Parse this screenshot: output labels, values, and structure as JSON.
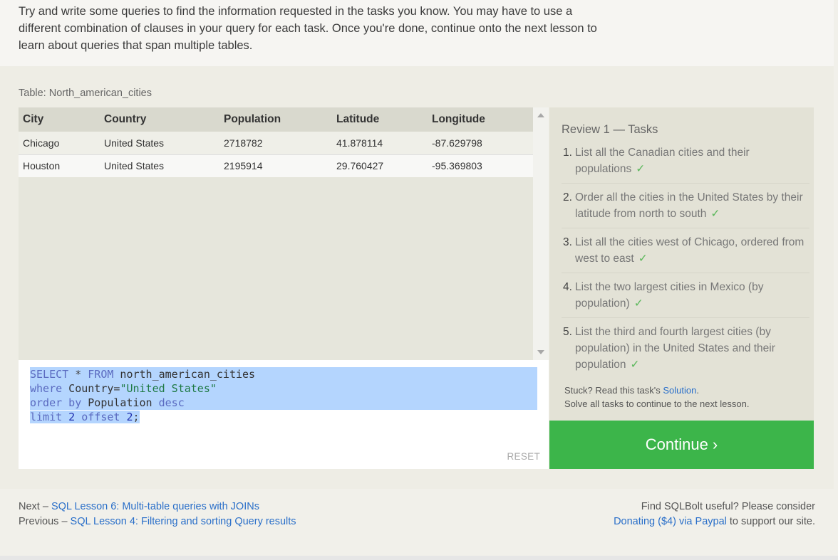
{
  "intro": {
    "text": "Try and write some queries to find the information requested in the tasks you know. You may have to use a different combination of clauses in your query for each task. Once you're done, continue onto the next lesson to learn about queries that span multiple tables."
  },
  "table": {
    "caption": "Table: North_american_cities",
    "columns": [
      "City",
      "Country",
      "Population",
      "Latitude",
      "Longitude"
    ],
    "rows": [
      [
        "Chicago",
        "United States",
        "2718782",
        "41.878114",
        "-87.629798"
      ],
      [
        "Houston",
        "United States",
        "2195914",
        "29.760427",
        "-95.369803"
      ]
    ]
  },
  "editor": {
    "line1": {
      "kw1": "SELECT",
      "op": " * ",
      "kw2": "FROM",
      "ident": " north_american_cities"
    },
    "line2": {
      "kw": "where",
      "ident": " Country",
      "op": "=",
      "str": "\"United States\""
    },
    "line3": {
      "kw": "order by",
      "ident": " Population ",
      "kw2": "desc"
    },
    "line4": {
      "kw": "limit",
      "num1": " 2 ",
      "kw2": "offset",
      "num2": " 2",
      "op": ";"
    },
    "reset_label": "RESET"
  },
  "tasks": {
    "title": "Review 1 — Tasks",
    "items": [
      {
        "num": "1.",
        "text": "List all the Canadian cities and their populations",
        "check": "✓"
      },
      {
        "num": "2.",
        "text": "Order all the cities in the United States by their latitude from north to south",
        "check": "✓"
      },
      {
        "num": "3.",
        "text": "List all the cities west of Chicago, ordered from west to east",
        "check": "✓"
      },
      {
        "num": "4.",
        "text": "List the two largest cities in Mexico (by population)",
        "check": "✓"
      },
      {
        "num": "5.",
        "text": "List the third and fourth largest cities (by population) in the United States and their population",
        "check": "✓"
      }
    ],
    "stuck_prefix": "Stuck? Read this task's ",
    "solution_link": "Solution",
    "stuck_suffix": ".",
    "solve_all": "Solve all tasks to continue to the next lesson."
  },
  "continue_label": "Continue ›",
  "footer": {
    "next_prefix": "Next – ",
    "next_link": "SQL Lesson 6: Multi-table queries with JOINs",
    "prev_prefix": "Previous – ",
    "prev_link": "SQL Lesson 4: Filtering and sorting Query results",
    "support_line1": "Find SQLBolt useful? Please consider",
    "donate_link": "Donating ($4) via Paypal",
    "support_suffix": " to support our site."
  },
  "colors": {
    "accent_green": "#3cb54a",
    "link_blue": "#2a6fc9",
    "selection": "#b4d5fe"
  }
}
